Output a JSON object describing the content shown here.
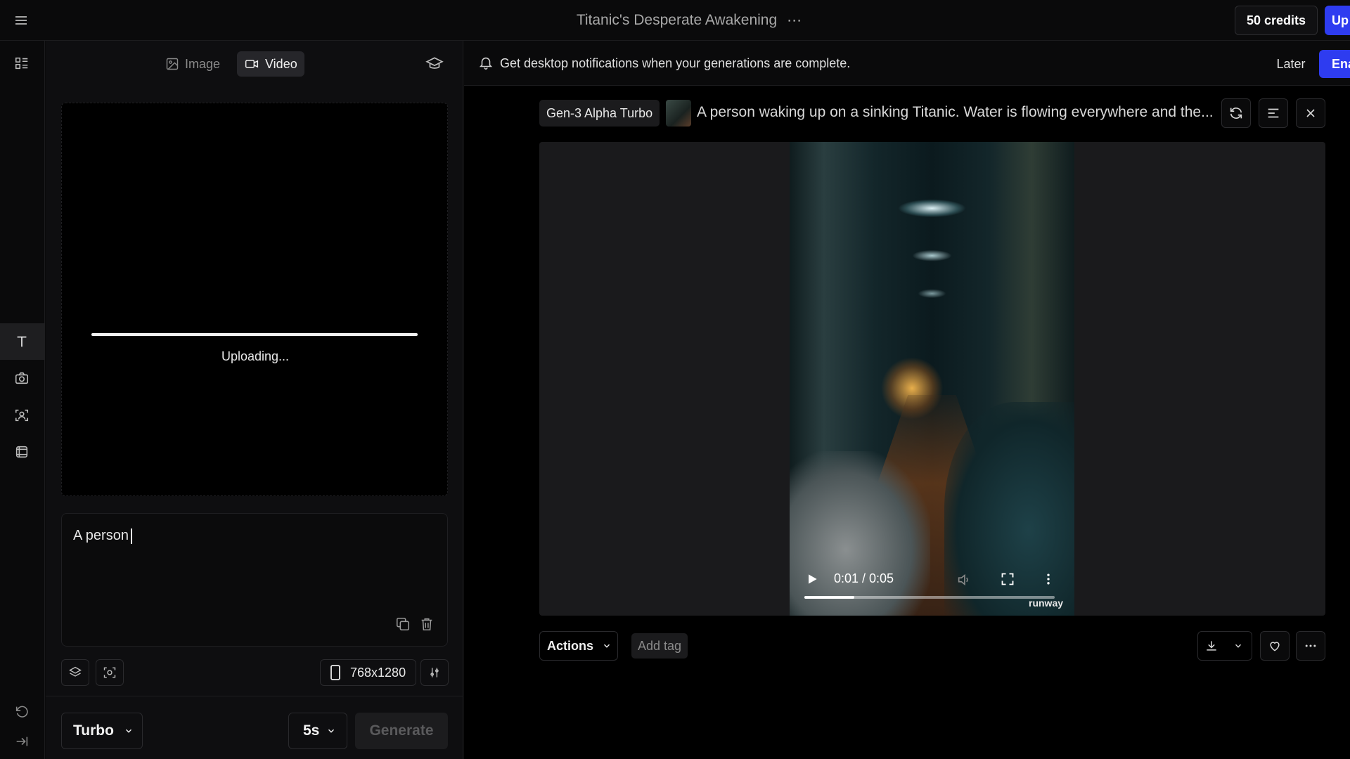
{
  "header": {
    "title": "Titanic's Desperate Awakening",
    "title_more": "⋯",
    "credits": "50 credits",
    "upgrade": "Up"
  },
  "panel": {
    "tabs": [
      {
        "label": "Image",
        "icon": "image-icon"
      },
      {
        "label": "Video",
        "icon": "video-icon",
        "active": true
      }
    ],
    "upload_status": "Uploading...",
    "upload_progress": 1.0,
    "prompt_value": "A person",
    "resolution": "768x1280",
    "mode": "Turbo",
    "duration": "5s",
    "generate_label": "Generate"
  },
  "rail": {
    "tools": [
      "menu-icon",
      "assets-icon",
      "text-icon",
      "camera-icon",
      "face-icon",
      "frames-icon",
      "undo-icon",
      "collapse-icon"
    ]
  },
  "notification": {
    "text": "Get desktop notifications when your generations are complete.",
    "later": "Later",
    "enable": "Ena"
  },
  "generation": {
    "model": "Gen-3 Alpha Turbo",
    "prompt": "A person waking up on a sinking Titanic. Water is flowing everywhere and the...",
    "player": {
      "time": "0:01 / 0:05",
      "progress": 0.2,
      "watermark": "runway"
    },
    "actions_label": "Actions",
    "add_tag": "Add tag"
  },
  "colors": {
    "accent": "#2e3cf0",
    "background": "#000000",
    "panel": "#0e0e10"
  }
}
